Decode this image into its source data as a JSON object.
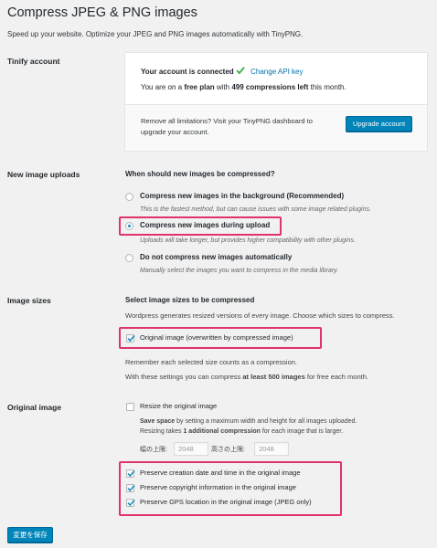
{
  "header": {
    "title": "Compress JPEG & PNG images",
    "subtitle": "Speed up your website. Optimize your JPEG and PNG images automatically with TinyPNG."
  },
  "account": {
    "label": "Tinify account",
    "connected_text": "Your account is connected",
    "change_key_link": "Change API key",
    "plan_prefix": "You are on a ",
    "plan_name": "free plan",
    "plan_middle": " with ",
    "compressions_left": "499 compressions left",
    "plan_suffix": " this month.",
    "remove_limits_line1": "Remove all limitations? Visit your TinyPNG dashboard to",
    "remove_limits_line2": "upgrade your account.",
    "upgrade_button": "Upgrade account"
  },
  "uploads": {
    "label": "New image uploads",
    "question": "When should new images be compressed?",
    "options": [
      {
        "label": "Compress new images in the background (Recommended)",
        "hint": "This is the fastest method, but can cause issues with some image related plugins.",
        "selected": false
      },
      {
        "label": "Compress new images during upload",
        "hint": "Uploads will take longer, but provides higher compatibility with other plugins.",
        "selected": true
      },
      {
        "label": "Do not compress new images automatically",
        "hint": "Manually select the images you want to compress in the media library.",
        "selected": false
      }
    ]
  },
  "sizes": {
    "label": "Image sizes",
    "heading": "Select image sizes to be compressed",
    "description": "Wordpress generates resized versions of every image. Choose which sizes to compress.",
    "original_option": "Original image (overwritten by compressed image)",
    "original_checked": true,
    "note1": "Remember each selected size counts as a compression.",
    "note2_prefix": "With these settings you can compress ",
    "note2_bold": "at least 500 images",
    "note2_suffix": " for free each month."
  },
  "original": {
    "label": "Original image",
    "resize_option": "Resize the original image",
    "resize_checked": false,
    "save_space_bold": "Save space",
    "save_space_rest": " by setting a maximum width and height for all images uploaded.",
    "resize_cost_prefix": "Resizing takes ",
    "resize_cost_bold": "1 additional compression",
    "resize_cost_suffix": " for each image that is larger.",
    "width_label": "幅の上限:",
    "width_value": "2048",
    "height_label": "高さの上限:",
    "height_value": "2048",
    "preserve_options": [
      {
        "label": "Preserve creation date and time in the original image",
        "checked": true
      },
      {
        "label": "Preserve copyright information in the original image",
        "checked": true
      },
      {
        "label": "Preserve GPS location in the original image (JPEG only)",
        "checked": true
      }
    ]
  },
  "footer": {
    "save_button": "変更を保存"
  },
  "colors": {
    "highlight": "#e0336a",
    "primary_button": "#0085ba",
    "link": "#0073aa",
    "check_green": "#46b450"
  }
}
